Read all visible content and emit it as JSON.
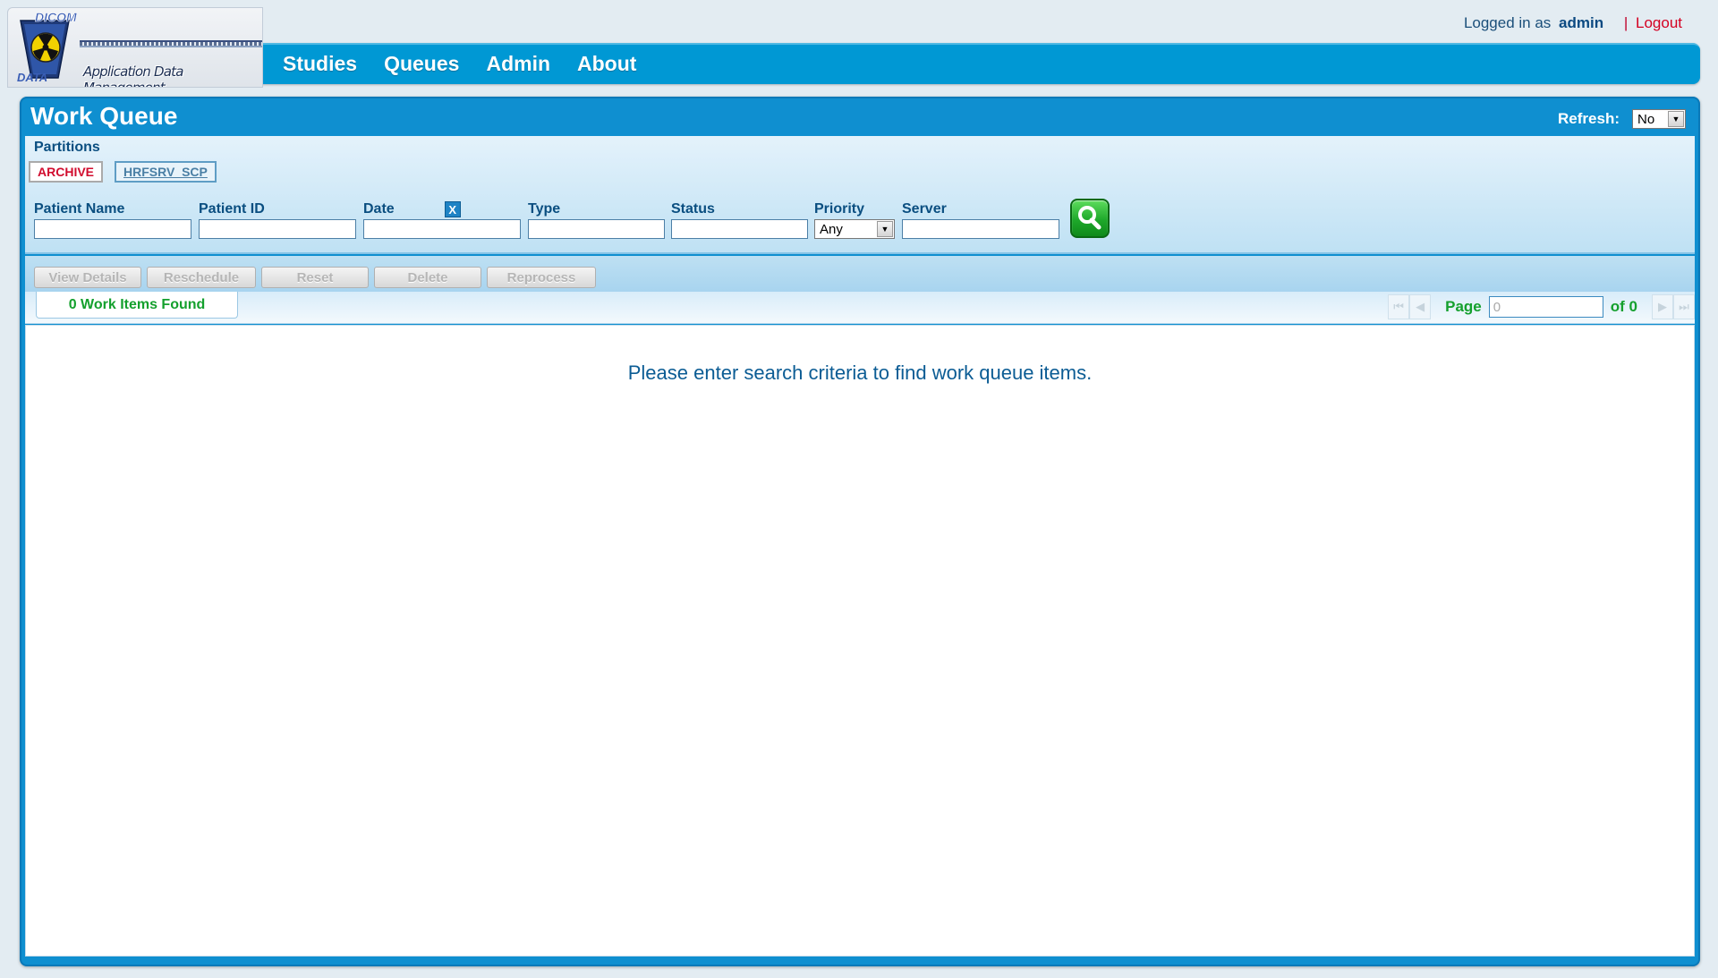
{
  "header": {
    "logo": {
      "top_text": "DICOM",
      "bottom_text": "DATA",
      "caption": "Application Data Management"
    },
    "login_prefix": "Logged in as",
    "username": "admin",
    "separator": "|",
    "logout_label": "Logout",
    "nav": [
      "Studies",
      "Queues",
      "Admin",
      "About"
    ]
  },
  "page": {
    "title": "Work Queue",
    "refresh_label": "Refresh:",
    "refresh_value": "No"
  },
  "partitions": {
    "label": "Partitions",
    "items": [
      "ARCHIVE",
      "HRFSRV_SCP"
    ],
    "active": "ARCHIVE"
  },
  "filters": {
    "patient_name": {
      "label": "Patient Name",
      "value": ""
    },
    "patient_id": {
      "label": "Patient ID",
      "value": ""
    },
    "date": {
      "label": "Date",
      "value": "",
      "clear_label": "X"
    },
    "type": {
      "label": "Type",
      "value": ""
    },
    "status": {
      "label": "Status",
      "value": ""
    },
    "priority": {
      "label": "Priority",
      "value": "Any"
    },
    "server": {
      "label": "Server",
      "value": ""
    }
  },
  "actions": [
    "View Details",
    "Reschedule",
    "Reset",
    "Delete",
    "Reprocess"
  ],
  "results": {
    "found_text": "0 Work Items Found",
    "page_label": "Page",
    "page_value": "0",
    "of_text": "of 0",
    "empty_message": "Please enter search criteria to find work queue items."
  },
  "colors": {
    "navbar": "#0098d4",
    "panel": "#0f8fd0",
    "accent_green": "#14a02d",
    "logout_red": "#d40022"
  },
  "icons": {
    "search": "search-icon",
    "logo_emblem": "radiation-icon",
    "pager": [
      "first-page-icon",
      "previous-page-icon",
      "next-page-icon",
      "last-page-icon"
    ]
  }
}
